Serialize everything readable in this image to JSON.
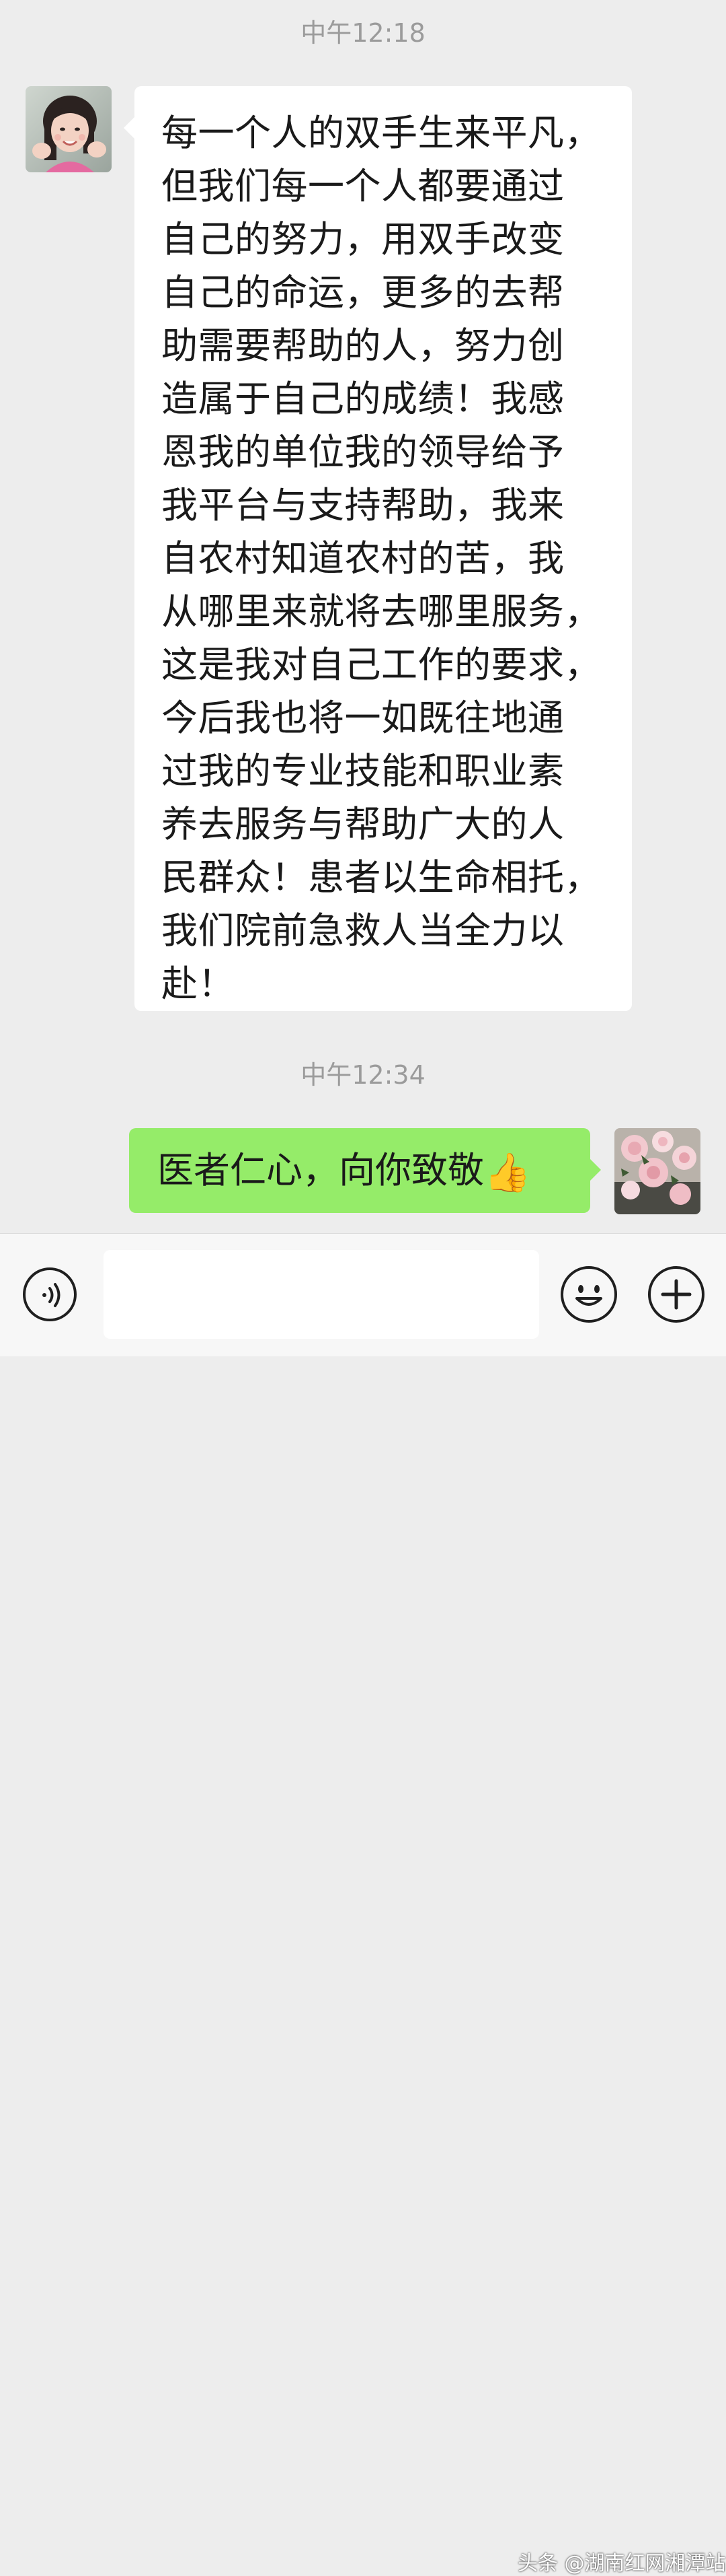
{
  "timestamps": {
    "first": "中午12:18",
    "second": "中午12:34"
  },
  "messages": [
    {
      "side": "left",
      "avatar": "girl-avatar",
      "text": "每一个人的双手生来平凡，\n但我们每一个人都要通过\n自己的努力，用双手改变\n自己的命运，更多的去帮\n助需要帮助的人，努力创\n造属于自己的成绩！我感\n恩我的单位我的领导给予\n我平台与支持帮助，我来\n自农村知道农村的苦，我\n从哪里来就将去哪里服务，\n这是我对自己工作的要求，\n今后我也将一如既往地通\n过我的专业技能和职业素\n养去服务与帮助广大的人\n民群众！患者以生命相托，\n我们院前急救人当全力以\n赴！"
    },
    {
      "side": "right",
      "avatar": "roses-avatar",
      "text": "医者仁心，向你致敬",
      "emoji": "👍"
    }
  ],
  "input_bar": {
    "voice_icon": "voice-icon",
    "emoji_icon": "smiley-icon",
    "plus_icon": "plus-icon",
    "input_value": ""
  },
  "watermark": "头条 @湖南红网湘潭站",
  "colors": {
    "background": "#ededed",
    "sent_bubble": "#95ec69",
    "received_bubble": "#ffffff",
    "timestamp": "#9b9b9b"
  }
}
